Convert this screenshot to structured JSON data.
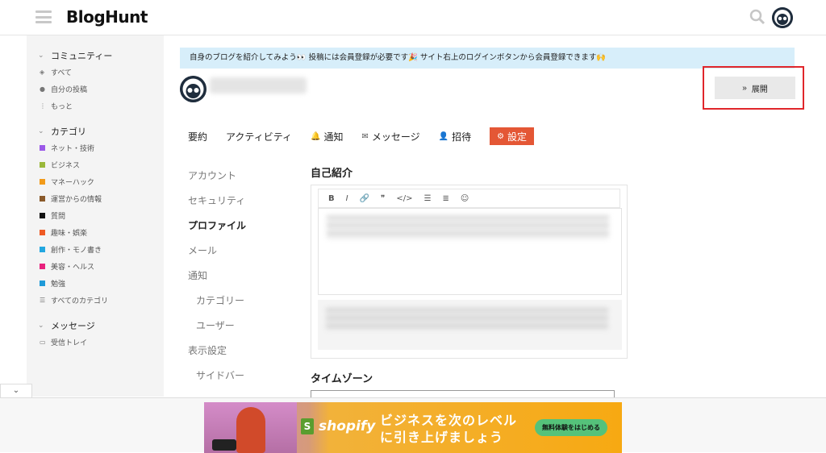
{
  "header": {
    "logo": "BlogHunt",
    "menu_icon": "hamburger-icon",
    "search_icon": "search-icon"
  },
  "sidebar": {
    "sections": [
      {
        "label": "コミュニティー",
        "items": [
          {
            "label": "すべて",
            "icon": "layers-icon"
          },
          {
            "label": "自分の投稿",
            "icon": "user-icon"
          },
          {
            "label": "もっと",
            "icon": "more-vertical-icon"
          }
        ]
      },
      {
        "label": "カテゴリ",
        "items": [
          {
            "label": "ネット・技術",
            "color": "#9b59e8"
          },
          {
            "label": "ビジネス",
            "color": "#9ab83a"
          },
          {
            "label": "マネーハック",
            "color": "#f29b1a"
          },
          {
            "label": "運営からの情報",
            "color": "#8a5a2b"
          },
          {
            "label": "質問",
            "color": "#111111"
          },
          {
            "label": "趣味・娯楽",
            "color": "#ee5a24"
          },
          {
            "label": "創作・モノ書き",
            "color": "#23a7e0"
          },
          {
            "label": "美容・ヘルス",
            "color": "#e8217d"
          },
          {
            "label": "勉強",
            "color": "#1f9ad8"
          },
          {
            "label": "すべてのカテゴリ",
            "icon": "list-icon"
          }
        ]
      },
      {
        "label": "メッセージ",
        "items": [
          {
            "label": "受信トレイ",
            "icon": "inbox-icon"
          }
        ]
      }
    ]
  },
  "banner": "自身のブログを紹介してみよう👀 投稿には会員登録が必要です🎉 サイト右上のログインボタンから会員登録できます🙌",
  "expand_button": "展開",
  "tabs": [
    {
      "label": "要約",
      "icon": ""
    },
    {
      "label": "アクティビティ",
      "icon": ""
    },
    {
      "label": "通知",
      "icon": "🔔"
    },
    {
      "label": "メッセージ",
      "icon": "✉"
    },
    {
      "label": "招待",
      "icon": "👤"
    },
    {
      "label": "設定",
      "icon": "⚙"
    }
  ],
  "settings_nav": [
    {
      "label": "アカウント",
      "style": "normal"
    },
    {
      "label": "セキュリティ",
      "style": "normal"
    },
    {
      "label": "プロファイル",
      "style": "active"
    },
    {
      "label": "メール",
      "style": "normal"
    },
    {
      "label": "通知",
      "style": "normal"
    },
    {
      "label": "カテゴリー",
      "style": "sub"
    },
    {
      "label": "ユーザー",
      "style": "sub"
    },
    {
      "label": "表示設定",
      "style": "normal"
    },
    {
      "label": "サイドバー",
      "style": "sub"
    }
  ],
  "profile": {
    "bio_title": "自己紹介",
    "toolbar": [
      "B",
      "I",
      "🔗",
      "❞",
      "</>",
      "☰",
      "≣",
      "☺"
    ],
    "timezone_title": "タイムゾーン"
  },
  "ad": {
    "brand": "shopify",
    "headline_1": "ビジネスを次のレベル",
    "headline_2": "に引き上げましょう",
    "cta": "無料体験をはじめる"
  }
}
